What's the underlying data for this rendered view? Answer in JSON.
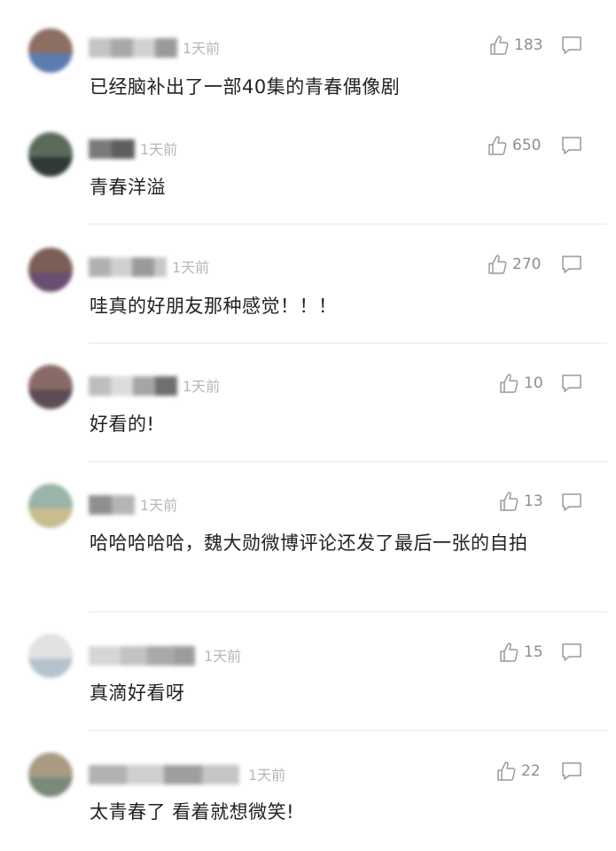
{
  "comments": [
    {
      "time": "1天前",
      "likes": "183",
      "text": "已经脑补出了一部40集的青春偶像剧",
      "avatar_colors": [
        "#8d6e63",
        "#5c7cb0"
      ],
      "name_colors": [
        "#c4c4c4",
        "#a8a8a8",
        "#d2d2d2",
        "#9a9a9a"
      ]
    },
    {
      "time": "1天前",
      "likes": "650",
      "text": "青春洋溢",
      "avatar_colors": [
        "#5b6b5a",
        "#2f3a35"
      ],
      "name_colors": [
        "#7a7a7a",
        "#5e5e5e"
      ]
    },
    {
      "time": "1天前",
      "likes": "270",
      "text": "哇真的好朋友那种感觉！！！",
      "avatar_colors": [
        "#7d5e56",
        "#6a4e70"
      ],
      "name_colors": [
        "#b0b0b0",
        "#d0d0d0",
        "#9a9a9a",
        "#c8c8c8"
      ]
    },
    {
      "time": "1天前",
      "likes": "10",
      "text": "好看的!",
      "avatar_colors": [
        "#8a6a66",
        "#5d4c55"
      ],
      "name_colors": [
        "#bdbdbd",
        "#dcdcdc",
        "#a5a5a5",
        "#6f6f6f"
      ]
    },
    {
      "time": "1天前",
      "likes": "13",
      "text": "哈哈哈哈哈，魏大勋微博评论还发了最后一张的自拍",
      "avatar_colors": [
        "#9bb4a8",
        "#c8bd8f"
      ],
      "name_colors": [
        "#8f8f8f",
        "#b5b5b5"
      ]
    },
    {
      "time": "1天前",
      "likes": "15",
      "text": "真滴好看呀",
      "avatar_colors": [
        "#e2e2e2",
        "#b7c2cf"
      ],
      "name_colors": [
        "#d6d6d6",
        "#c2c2c2",
        "#a9a9a9",
        "#9c9c9c"
      ]
    },
    {
      "time": "1天前",
      "likes": "22",
      "text": "太青春了 看着就想微笑!",
      "avatar_colors": [
        "#a99b82",
        "#7a8a78"
      ],
      "name_colors": [
        "#b2b2b2",
        "#cfcfcf",
        "#9e9e9e",
        "#c5c5c5"
      ]
    }
  ]
}
